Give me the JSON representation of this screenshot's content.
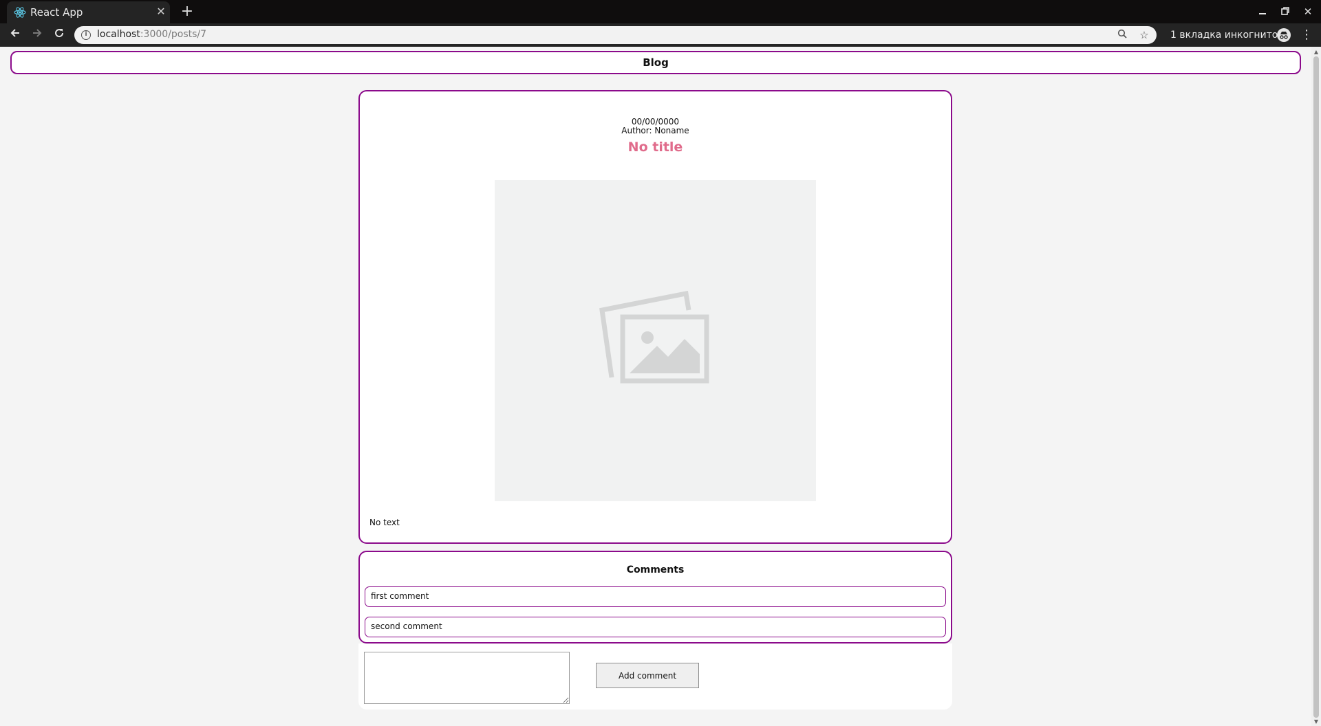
{
  "browser": {
    "tab_title": "React App",
    "new_tab_symbol": "+",
    "close_symbol": "✕",
    "url_host": "localhost",
    "url_path": ":3000/posts/7",
    "incognito_label": "1 вкладка инкогнито",
    "icons": [
      "react-favicon-icon",
      "back-icon",
      "forward-icon",
      "reload-icon",
      "info-icon",
      "zoom-icon",
      "star-icon",
      "incognito-icon",
      "menu-icon",
      "minimize-icon",
      "restore-icon",
      "close-icon"
    ]
  },
  "header": {
    "title": "Blog"
  },
  "post": {
    "date": "00/00/0000",
    "author": "Author: Noname",
    "title": "No title",
    "text": "No text",
    "image_icon": "image-placeholder-icon"
  },
  "comments": {
    "title": "Comments",
    "items": [
      {
        "text": "first comment"
      },
      {
        "text": "second comment"
      }
    ]
  },
  "add_comment": {
    "input_value": "",
    "button_label": "Add comment"
  },
  "colors": {
    "accent_border": "#8b0a8b",
    "title_pink": "#e06b8b",
    "page_bg": "#f4f4f4"
  }
}
